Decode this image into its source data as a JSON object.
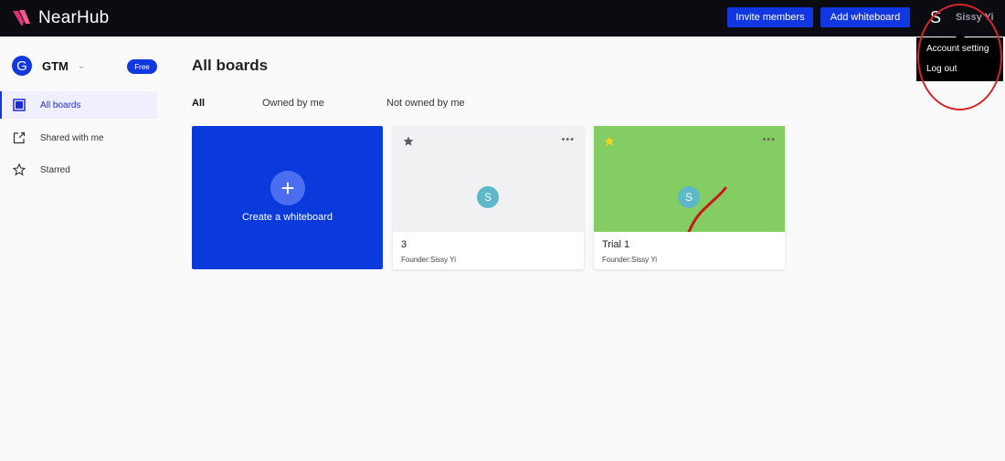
{
  "app": {
    "name": "NearHub",
    "brand_color": "#1037e0"
  },
  "topbar": {
    "invite_label": "Invite members",
    "add_label": "Add whiteboard",
    "user_initial": "S",
    "user_name": "Sissy Yi"
  },
  "user_menu": {
    "items": [
      "Account setting",
      "Log out"
    ]
  },
  "sidebar": {
    "workspace_initial": "G",
    "workspace_name": "GTM",
    "plan_badge": "Free",
    "items": [
      {
        "label": "All boards",
        "icon": "board-icon",
        "active": true
      },
      {
        "label": "Shared with me",
        "icon": "share-icon",
        "active": false
      },
      {
        "label": "Starred",
        "icon": "star-icon",
        "active": false
      }
    ]
  },
  "main": {
    "title": "All boards",
    "tabs": [
      "All",
      "Owned by me",
      "Not owned by me"
    ],
    "active_tab": "All",
    "create_label": "Create a whiteboard",
    "boards": [
      {
        "title": "3",
        "founder": "Founder:Sissy Yi",
        "avatar": "S",
        "starred": false,
        "thumb_color": "#f1f1f3"
      },
      {
        "title": "Trial 1",
        "founder": "Founder:Sissy Yi",
        "avatar": "S",
        "starred": true,
        "thumb_color": "#84cd63"
      }
    ]
  }
}
